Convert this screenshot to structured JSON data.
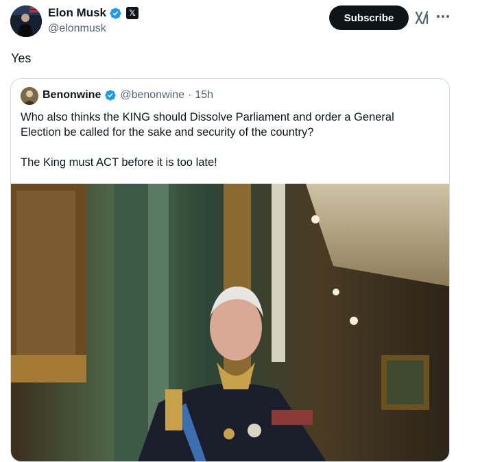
{
  "author": {
    "display_name": "Elon Musk",
    "handle": "@elonmusk",
    "verified_icon": "verified-badge-icon",
    "affiliation_icon": "x-logo-icon",
    "affiliation_glyph": "𝕏"
  },
  "actions": {
    "subscribe_label": "Subscribe",
    "grok_icon": "grok-icon",
    "more_icon": "more-options-icon"
  },
  "tweet": {
    "text": "Yes"
  },
  "quoted": {
    "display_name": "Benonwine",
    "handle": "@benonwine",
    "separator": "·",
    "time": "15h",
    "paragraph_1": "Who also thinks the KING should Dissolve Parliament and order a General Election be called for the sake and security of the country?",
    "paragraph_2": "The King must ACT before it is too late!",
    "image": "portrait photo of the King in military uniform in an ornate palace corridor"
  },
  "colors": {
    "text": "#0f1419",
    "secondary": "#536471",
    "verified_blue": "#1d9bf0",
    "border": "#cfd9de"
  }
}
